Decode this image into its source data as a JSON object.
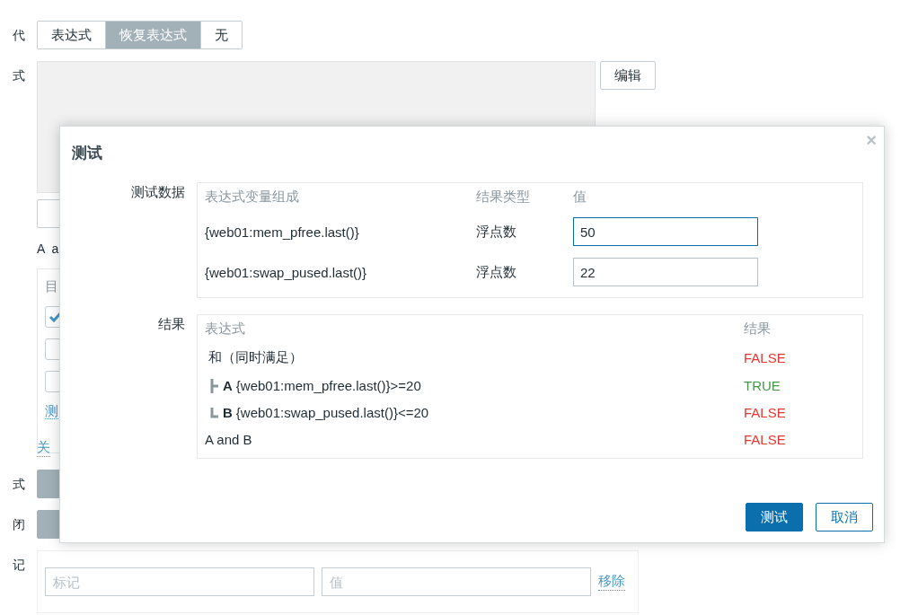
{
  "form": {
    "iteration": {
      "label": "代",
      "options": [
        {
          "label": "表达式",
          "selected": false
        },
        {
          "label": "恢复表达式",
          "selected": true
        },
        {
          "label": "无",
          "selected": false
        }
      ]
    },
    "expression": {
      "label": "式",
      "edit_button": "编辑"
    },
    "hint": "A a",
    "conditions": {
      "heading": "目",
      "checkboxes": [
        {
          "checked": true
        },
        {
          "checked": false
        },
        {
          "checked": false
        }
      ],
      "link": "测"
    },
    "close_link": "关",
    "mode": {
      "label": "式"
    },
    "close": {
      "label": "闭"
    },
    "tags": {
      "label": "记",
      "tag_placeholder": "标记",
      "value_placeholder": "值",
      "remove_link": "移除"
    }
  },
  "dialog": {
    "title": "测试",
    "close": "×",
    "test_data": {
      "label": "测试数据",
      "columns": [
        "表达式变量组成",
        "结果类型",
        "值"
      ],
      "rows": [
        {
          "variable": "{web01:mem_pfree.last()}",
          "type": "浮点数",
          "value": "50",
          "focused": true
        },
        {
          "variable": "{web01:swap_pused.last()}",
          "type": "浮点数",
          "value": "22",
          "focused": false
        }
      ]
    },
    "results": {
      "label": "结果",
      "columns": [
        "表达式",
        "结果"
      ],
      "rows": [
        {
          "kind": "group",
          "expression": "和（同时满足）",
          "result": "FALSE",
          "passed": false
        },
        {
          "kind": "middle",
          "letter": "A",
          "expression": "{web01:mem_pfree.last()}>=20",
          "result": "TRUE",
          "passed": true
        },
        {
          "kind": "last",
          "letter": "B",
          "expression": "{web01:swap_pused.last()}<=20",
          "result": "FALSE",
          "passed": false
        },
        {
          "kind": "summary",
          "expression": "A and B",
          "result": "FALSE",
          "passed": false
        }
      ]
    },
    "buttons": [
      {
        "label": "测试",
        "primary": true
      },
      {
        "label": "取消",
        "primary": false
      }
    ]
  }
}
